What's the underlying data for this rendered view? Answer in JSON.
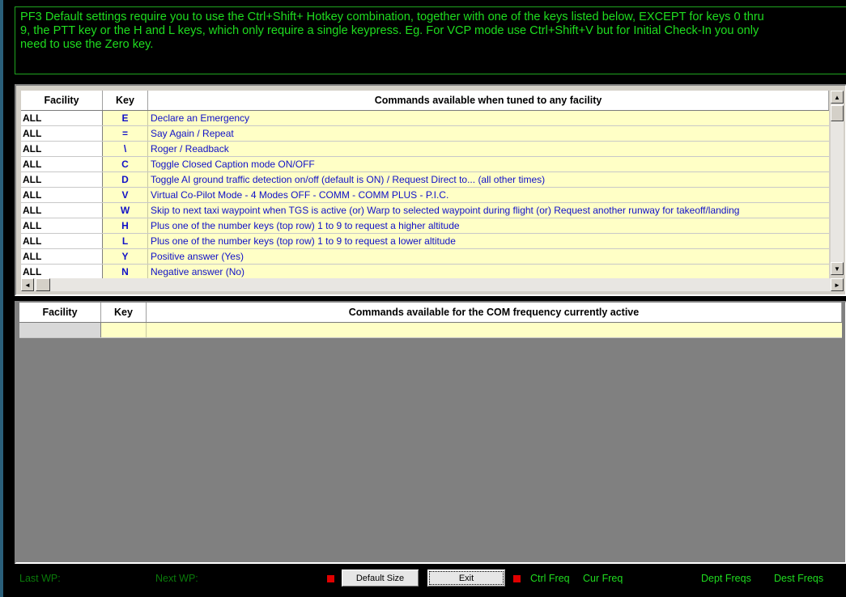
{
  "banner": {
    "line1": "PF3 Default settings require you to use the Ctrl+Shift+ Hotkey combination, together with one of the keys listed below, EXCEPT for keys 0 thru",
    "line2": "9, the PTT key or the H and L keys, which only require a single keypress.  Eg. For VCP mode use Ctrl+Shift+V but for Initial Check-In you only",
    "line3": "need to use the Zero key."
  },
  "top_table": {
    "headers": {
      "facility": "Facility",
      "key": "Key",
      "commands": "Commands available when tuned to any facility"
    },
    "rows": [
      {
        "facility": "ALL",
        "key": "E",
        "command": "Declare an Emergency"
      },
      {
        "facility": "ALL",
        "key": "=",
        "command": "Say Again / Repeat"
      },
      {
        "facility": "ALL",
        "key": "\\",
        "command": "Roger / Readback"
      },
      {
        "facility": "ALL",
        "key": "C",
        "command": "Toggle Closed Caption mode ON/OFF"
      },
      {
        "facility": "ALL",
        "key": "D",
        "command": "Toggle AI ground traffic detection on/off (default is ON) / Request Direct to... (all other times)"
      },
      {
        "facility": "ALL",
        "key": "V",
        "command": "Virtual Co-Pilot Mode - 4 Modes OFF - COMM - COMM PLUS - P.I.C."
      },
      {
        "facility": "ALL",
        "key": "W",
        "command": "Skip to next taxi waypoint when TGS is active (or) Warp to selected waypoint during flight (or) Request another runway for takeoff/landing"
      },
      {
        "facility": "ALL",
        "key": "H",
        "command": "Plus one of the number keys (top row) 1 to 9 to request a higher altitude"
      },
      {
        "facility": "ALL",
        "key": "L",
        "command": "Plus one of the number keys (top row) 1 to 9 to request a lower altitude"
      },
      {
        "facility": "ALL",
        "key": "Y",
        "command": "Positive answer (Yes)"
      },
      {
        "facility": "ALL",
        "key": "N",
        "command": "Negative answer (No)"
      }
    ]
  },
  "bottom_table": {
    "headers": {
      "facility": "Facility",
      "key": "Key",
      "commands": "Commands available for the COM frequency currently active"
    }
  },
  "scroll": {
    "up": "▲",
    "down": "▼",
    "left": "◄",
    "right": "►"
  },
  "status_bar": {
    "last_wp": "Last WP:",
    "next_wp": "Next WP:",
    "default_size": "Default Size",
    "exit": "Exit",
    "ctrl_freq": "Ctrl Freq",
    "cur_freq": "Cur Freq",
    "dept_freqs": "Dept Freqs",
    "dest_freqs": "Dest Freqs"
  },
  "colors": {
    "banner_text": "#1fdc1f",
    "grid_yellow": "#ffffc6",
    "command_blue": "#1010c8",
    "indicator_red": "#e00000"
  }
}
